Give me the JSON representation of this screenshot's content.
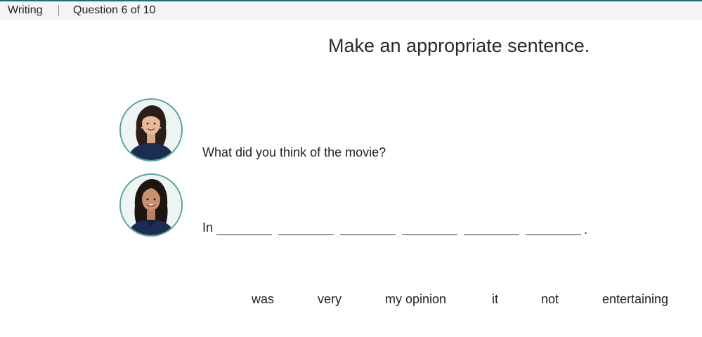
{
  "header": {
    "section": "Writing",
    "progress": "Question 6 of 10"
  },
  "colors": {
    "accent": "#1f6f6b",
    "avatar_border": "#5aa3a0",
    "header_bg": "#f4f4f4"
  },
  "instruction": "Make an appropriate sentence.",
  "dialogue": {
    "speaker_a": {
      "avatar": "woman-portrait-avatar",
      "text": "What did you think of the movie?"
    },
    "speaker_b": {
      "avatar": "woman-portrait-avatar",
      "prefix": "In",
      "blanks": [
        "",
        "",
        "",
        "",
        "",
        ""
      ],
      "suffix": "."
    }
  },
  "word_bank": [
    "was",
    "very",
    "my opinion",
    "it",
    "not",
    "entertaining"
  ]
}
